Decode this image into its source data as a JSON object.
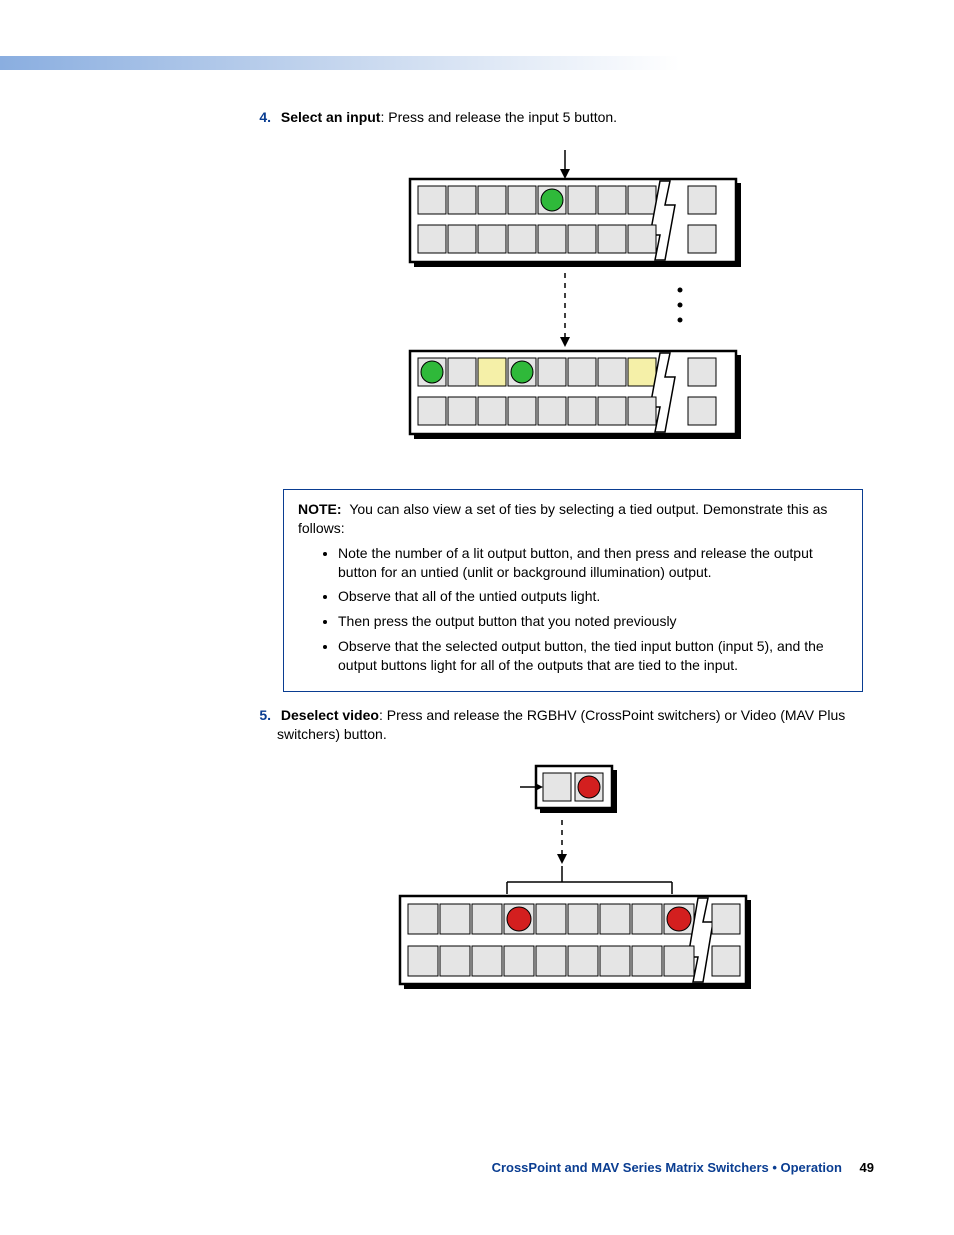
{
  "step4": {
    "num": "4.",
    "bold": "Select an input",
    "rest": ": Press and release the input 5 button."
  },
  "note": {
    "label": "NOTE:",
    "intro": "You can also view a set of ties by selecting a tied output. Demonstrate this as follows:",
    "bullets": [
      "Note the number of a lit output button, and then press and release the output button for an untied (unlit or background illumination) output.",
      "Observe that all of the untied outputs light.",
      "Then press the output button that you noted previously",
      "Observe that the selected output button, the tied input button (input 5), and the output buttons light for all of the outputs that are tied to the input."
    ]
  },
  "step5": {
    "num": "5.",
    "bold": "Deselect video",
    "rest": ": Press and release the RGBHV (CrossPoint switchers) or Video (MAV Plus switchers) button."
  },
  "footer": {
    "title": "CrossPoint and MAV Series Matrix Switchers • Operation",
    "page": "49"
  }
}
